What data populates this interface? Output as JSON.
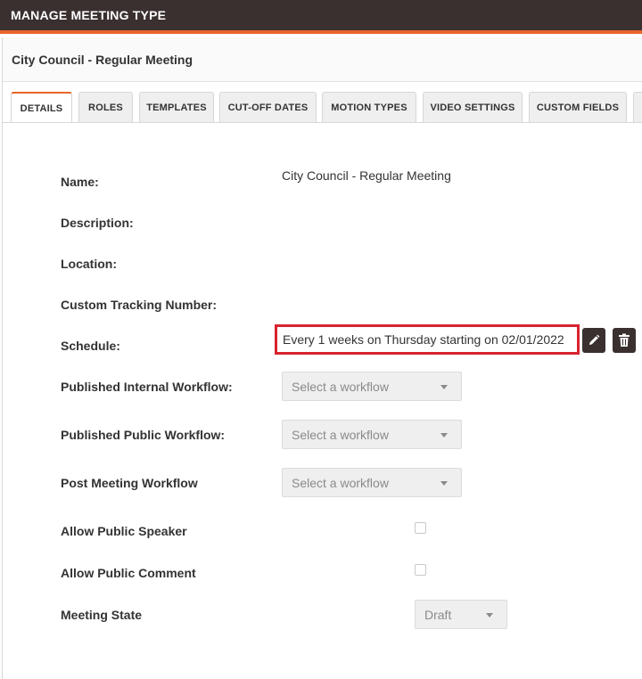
{
  "header": {
    "title": "MANAGE MEETING TYPE"
  },
  "subheader": {
    "title": "City Council - Regular Meeting"
  },
  "tabs": [
    {
      "label": "DETAILS",
      "active": true
    },
    {
      "label": "ROLES"
    },
    {
      "label": "TEMPLATES"
    },
    {
      "label": "CUT-OFF DATES"
    },
    {
      "label": "MOTION TYPES"
    },
    {
      "label": "VIDEO SETTINGS"
    },
    {
      "label": "CUSTOM FIELDS"
    }
  ],
  "form": {
    "name_label": "Name:",
    "name_value": "City Council - Regular Meeting",
    "description_label": "Description:",
    "location_label": "Location:",
    "tracking_label": "Custom Tracking Number:",
    "schedule_label": "Schedule:",
    "schedule_value": "Every 1 weeks on Thursday starting on 02/01/2022",
    "internal_workflow_label": "Published Internal Workflow:",
    "internal_workflow_value": "Select a workflow",
    "public_workflow_label": "Published Public Workflow:",
    "public_workflow_value": "Select a workflow",
    "post_workflow_label": "Post Meeting Workflow",
    "post_workflow_value": "Select a workflow",
    "public_speaker_label": "Allow Public Speaker",
    "public_speaker_checked": false,
    "public_comment_label": "Allow Public Comment",
    "public_comment_checked": false,
    "state_label": "Meeting State",
    "state_value": "Draft"
  },
  "colors": {
    "header_bg": "#3a3030",
    "accent": "#e8652a",
    "highlight": "#d9232f"
  }
}
